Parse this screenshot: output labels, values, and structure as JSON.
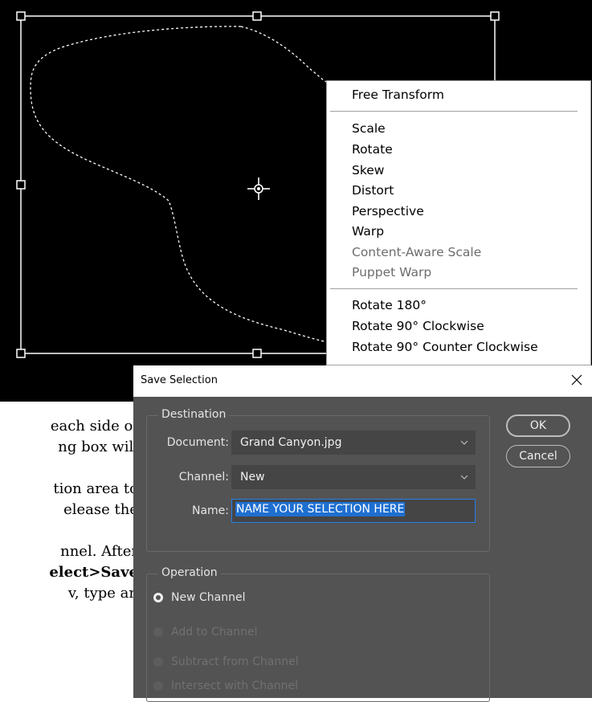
{
  "context_menu": {
    "groups": [
      [
        {
          "label": "Free Transform",
          "enabled": true
        }
      ],
      [
        {
          "label": "Scale",
          "enabled": true
        },
        {
          "label": "Rotate",
          "enabled": true
        },
        {
          "label": "Skew",
          "enabled": true
        },
        {
          "label": "Distort",
          "enabled": true
        },
        {
          "label": "Perspective",
          "enabled": true
        },
        {
          "label": "Warp",
          "enabled": true
        },
        {
          "label": "Content-Aware Scale",
          "enabled": false
        },
        {
          "label": "Puppet Warp",
          "enabled": false
        }
      ],
      [
        {
          "label": "Rotate 180°",
          "enabled": true
        },
        {
          "label": "Rotate 90° Clockwise",
          "enabled": true
        },
        {
          "label": "Rotate 90° Counter Clockwise",
          "enabled": true
        }
      ]
    ]
  },
  "document_text": {
    "line1": "each side of",
    "line2": "ng box will",
    "line3": "tion area to",
    "line4": "elease the",
    "line5": "nnel. After",
    "line6_bold": "elect>Save",
    "line7": "v, type an"
  },
  "dialog": {
    "title": "Save Selection",
    "destination": {
      "legend": "Destination",
      "document_label": "Document:",
      "document_value": "Grand Canyon.jpg",
      "channel_label": "Channel:",
      "channel_value": "New",
      "name_label": "Name:",
      "name_value": "NAME YOUR SELECTION HERE"
    },
    "operation": {
      "legend": "Operation",
      "options": [
        {
          "label": "New Channel",
          "checked": true,
          "enabled": true
        },
        {
          "label": "Add to Channel",
          "checked": false,
          "enabled": false
        },
        {
          "label": "Subtract from Channel",
          "checked": false,
          "enabled": false
        },
        {
          "label": "Intersect with Channel",
          "checked": false,
          "enabled": false
        }
      ]
    },
    "ok_label": "OK",
    "cancel_label": "Cancel"
  },
  "icons": [
    "close-icon",
    "chevron-down-icon",
    "reference-point-icon",
    "transform-handle-icon"
  ],
  "colors": {
    "canvas": "#000000",
    "dialog_bg": "#535353",
    "input_bg": "#454545",
    "selection_highlight": "#1e6fd0",
    "focus_border": "#2680eb"
  }
}
